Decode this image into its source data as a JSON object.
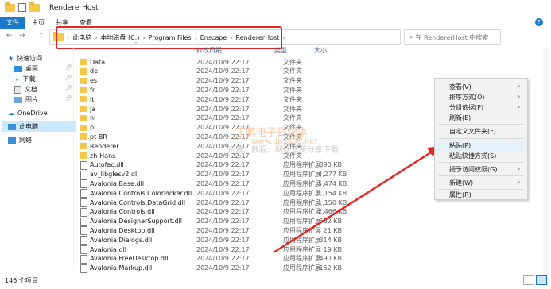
{
  "window": {
    "title": "RendererHost"
  },
  "ribbon": {
    "file": "文件",
    "home": "主页",
    "share": "共享",
    "view": "查看",
    "help": "?"
  },
  "nav": {
    "back": "←",
    "forward": "→",
    "up": "↑"
  },
  "address": {
    "root": "此电脑",
    "drive": "本地磁盘 (C:)",
    "p1": "Program Files",
    "p2": "Enscape",
    "p3": "RendererHost",
    "sep": "›"
  },
  "search": {
    "placeholder": "在 RendererHost 中搜索"
  },
  "columns": {
    "date": "修改日期",
    "type": "类型",
    "size": "大小"
  },
  "sidebar": {
    "quick_access": "快速访问",
    "desktop": "桌面",
    "downloads": "下载",
    "documents": "文档",
    "pictures": "图片",
    "onedrive": "OneDrive",
    "this_pc": "此电脑",
    "network": "网络"
  },
  "files": [
    {
      "name": "Data",
      "date": "2024/10/9 22:17",
      "type": "文件夹",
      "size": ""
    },
    {
      "name": "de",
      "date": "2024/10/9 22:17",
      "type": "文件夹",
      "size": ""
    },
    {
      "name": "es",
      "date": "2024/10/9 22:17",
      "type": "文件夹",
      "size": ""
    },
    {
      "name": "fr",
      "date": "2024/10/9 22:17",
      "type": "文件夹",
      "size": ""
    },
    {
      "name": "it",
      "date": "2024/10/9 22:17",
      "type": "文件夹",
      "size": ""
    },
    {
      "name": "ja",
      "date": "2024/10/9 22:17",
      "type": "文件夹",
      "size": ""
    },
    {
      "name": "nl",
      "date": "2024/10/9 22:17",
      "type": "文件夹",
      "size": ""
    },
    {
      "name": "pl",
      "date": "2024/10/9 22:17",
      "type": "文件夹",
      "size": ""
    },
    {
      "name": "pt-BR",
      "date": "2024/10/9 22:17",
      "type": "文件夹",
      "size": ""
    },
    {
      "name": "Renderer",
      "date": "2024/10/9 22:17",
      "type": "文件夹",
      "size": ""
    },
    {
      "name": "zh-Hans",
      "date": "2024/10/9 22:17",
      "type": "文件夹",
      "size": ""
    },
    {
      "name": "Autofac.dll",
      "date": "2024/10/9 22:17",
      "type": "应用程序扩展",
      "size": "890 KB"
    },
    {
      "name": "av_libglesv2.dll",
      "date": "2024/10/9 22:17",
      "type": "应用程序扩展",
      "size": "4,277 KB"
    },
    {
      "name": "Avalonia.Base.dll",
      "date": "2024/10/9 22:17",
      "type": "应用程序扩展",
      "size": "5,474 KB"
    },
    {
      "name": "Avalonia.Controls.ColorPicker.dll",
      "date": "2024/10/9 22:17",
      "type": "应用程序扩展",
      "size": "1,154 KB"
    },
    {
      "name": "Avalonia.Controls.DataGrid.dll",
      "date": "2024/10/9 22:17",
      "type": "应用程序扩展",
      "size": "1,150 KB"
    },
    {
      "name": "Avalonia.Controls.dll",
      "date": "2024/10/9 22:17",
      "type": "应用程序扩展",
      "size": "2,466 KB"
    },
    {
      "name": "Avalonia.DesignerSupport.dll",
      "date": "2024/10/9 22:17",
      "type": "应用程序扩展",
      "size": "502 KB"
    },
    {
      "name": "Avalonia.Desktop.dll",
      "date": "2024/10/9 22:17",
      "type": "应用程序扩展",
      "size": "21 KB"
    },
    {
      "name": "Avalonia.Dialogs.dll",
      "date": "2024/10/9 22:17",
      "type": "应用程序扩展",
      "size": "314 KB"
    },
    {
      "name": "Avalonia.dll",
      "date": "2024/10/9 22:17",
      "type": "应用程序扩展",
      "size": "19 KB"
    },
    {
      "name": "Avalonia.FreeDesktop.dll",
      "date": "2024/10/9 22:17",
      "type": "应用程序扩展",
      "size": "490 KB"
    },
    {
      "name": "Avalonia.Markup.dll",
      "date": "2024/10/9 22:17",
      "type": "应用程序扩展",
      "size": "152 KB"
    }
  ],
  "context_menu": {
    "view": "查看(V)",
    "sort": "排序方式(O)",
    "group": "分组依据(P)",
    "refresh": "刷新(E)",
    "customize": "自定义文件夹(F)...",
    "paste": "粘贴(P)",
    "paste_shortcut": "粘贴快捷方式(S)",
    "grant_access": "授予访问权限(G)",
    "new": "新建(W)",
    "properties": "属性(R)",
    "arrow": "›"
  },
  "watermark": {
    "line1": "丁鹏电子日记本",
    "line2": "www.dps006.net",
    "line3": "资源、教程、网盘直接分享下载"
  },
  "status": {
    "count": "146 个项目"
  },
  "colors": {
    "accent": "#1979ca",
    "annotation_red": "#e52521",
    "folder": "#f3c84b"
  }
}
